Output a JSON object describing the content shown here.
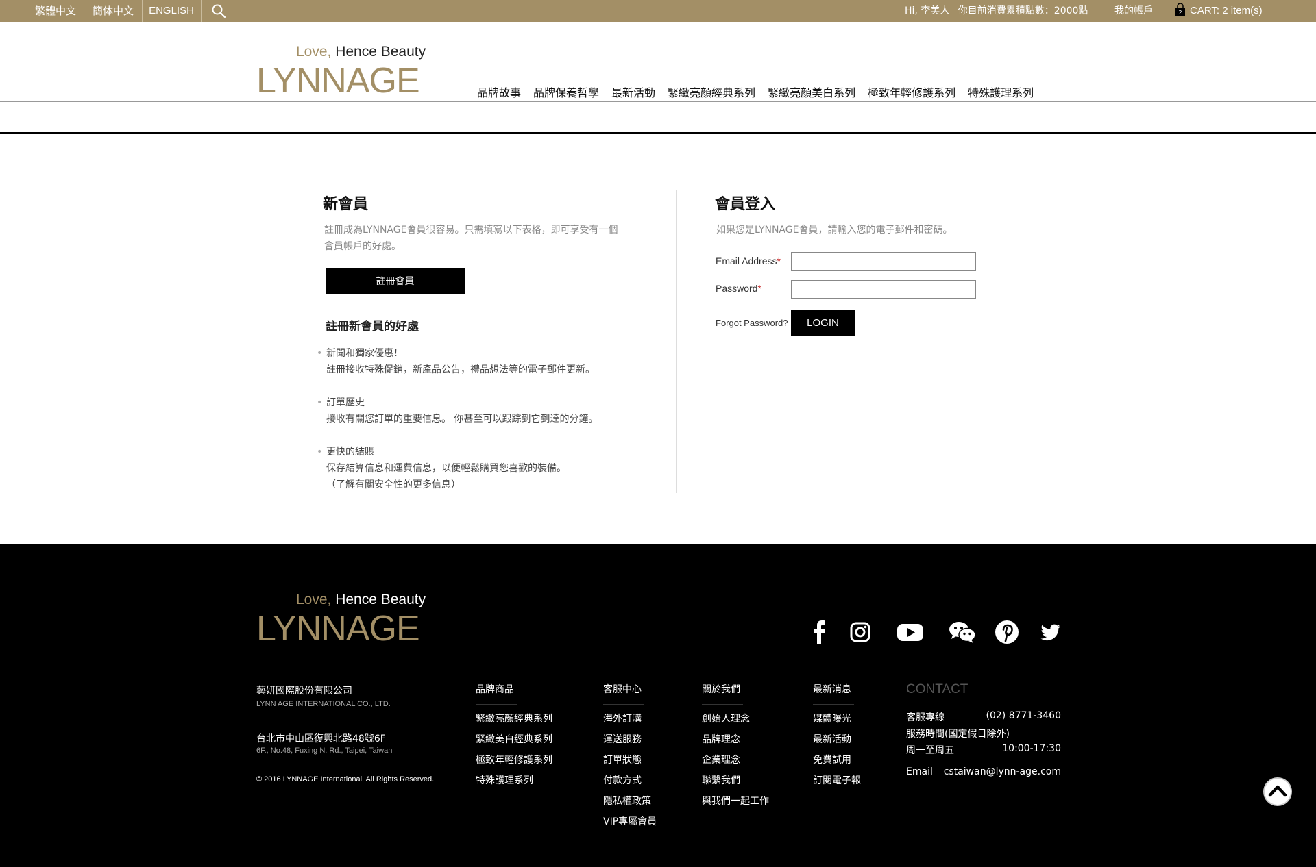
{
  "topbar": {
    "languages": [
      "繁體中文",
      "簡体中文",
      "ENGLISH"
    ],
    "greeting": "Hi, 李美人",
    "points": "你目前消費累積點數：2000點",
    "account": "我的帳戶",
    "cart_count": "2",
    "cart": "CART: 2 item(s)"
  },
  "brand": {
    "tagline_love": "Love,",
    "tagline_rest": " Hence Beauty",
    "wordmark": "LYNNAGE"
  },
  "nav": [
    "品牌故事",
    "品牌保養哲學",
    "最新活動",
    "緊緻亮顏經典系列",
    "緊緻亮顏美白系列",
    "極致年輕修護系列",
    "特殊護理系列"
  ],
  "new_member": {
    "title": "新會員",
    "desc_line1": "註冊成為LYNNAGE會員很容易。只需填寫以下表格，即可享受有一個",
    "desc_line2": "會員帳戶的好處。",
    "register_button": "註冊會員",
    "benefits_title": "註冊新會員的好處",
    "benefits": [
      {
        "title": "新聞和獨家優惠！",
        "lines": [
          "註冊接收特殊促銷，新產品公告，禮品想法等的電子郵件更新。"
        ]
      },
      {
        "title": "訂單歷史",
        "lines": [
          "接收有關您訂單的重要信息。 你甚至可以跟踪到它到達的分鐘。"
        ]
      },
      {
        "title": "更快的結賬",
        "lines": [
          "保存結算信息和運費信息，以便輕鬆購買您喜歡的裝備。",
          "（了解有關安全性的更多信息）"
        ]
      }
    ]
  },
  "login": {
    "title": "會員登入",
    "desc": "如果您是LYNNAGE會員，請輸入您的電子郵件和密碼。",
    "email_label": "Email Address",
    "password_label": "Password",
    "required_mark": "*",
    "email_value": "",
    "password_value": "",
    "forgot": "Forgot Password?",
    "login_button": "LOGIN"
  },
  "footer": {
    "company_name": "藝妍國際股份有限公司",
    "company_en": "LYNN AGE INTERNATIONAL CO., LTD.",
    "address": "台北市中山區復興北路48號6F",
    "address_en": "6F., No.48, Fuxing N. Rd., Taipei, Taiwan",
    "copyright": "© 2016 LYNNAGE International. All Rights Reserved.",
    "columns": [
      {
        "head": "品牌商品",
        "items": [
          "緊緻亮顏經典系列",
          "緊緻美白經典系列",
          "極致年輕修護系列",
          "特殊護理系列"
        ]
      },
      {
        "head": "客服中心",
        "items": [
          "海外訂購",
          "運送服務",
          "訂單狀態",
          "付款方式",
          "隱私權政策",
          "VIP專屬會員"
        ]
      },
      {
        "head": "關於我們",
        "items": [
          "創始人理念",
          "品牌理念",
          "企業理念",
          "聯繫我們",
          "與我們一起工作"
        ]
      },
      {
        "head": "最新消息",
        "items": [
          "媒體曝光",
          "最新活動",
          "免費試用",
          "訂閱電子報"
        ]
      }
    ],
    "contact": {
      "head": "CONTACT",
      "hotline_label": "客服專線",
      "hotline": "(02) 8771-3460",
      "hours_label": "服務時間(國定假日除外)",
      "days": "周一至周五",
      "hours": "10:00-17:30",
      "email_label": "Email",
      "email": "cstaiwan@lynn-age.com"
    },
    "social": [
      "facebook-icon",
      "instagram-icon",
      "youtube-icon",
      "wechat-icon",
      "pinterest-icon",
      "twitter-icon"
    ]
  }
}
